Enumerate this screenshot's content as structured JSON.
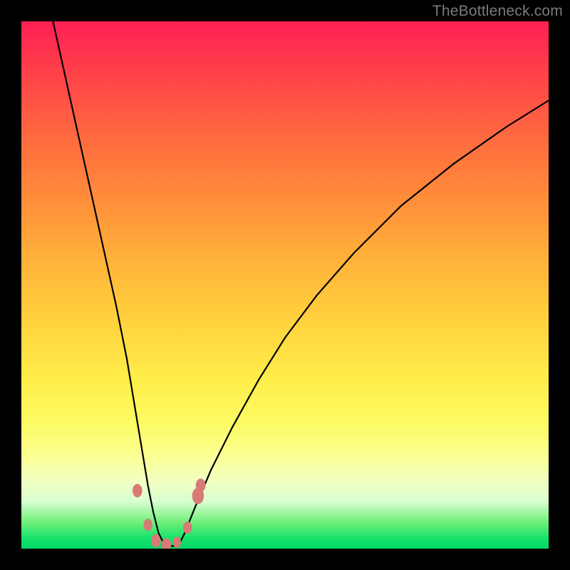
{
  "watermark": "TheBottleneck.com",
  "chart_data": {
    "type": "line",
    "title": "",
    "xlabel": "",
    "ylabel": "",
    "xlim": [
      0,
      100
    ],
    "ylim": [
      0,
      100
    ],
    "series": [
      {
        "name": "bottleneck-curve",
        "x": [
          6,
          8,
          10,
          12,
          14,
          16,
          18,
          20,
          21,
          22,
          23,
          24,
          25,
          26,
          27,
          28,
          29,
          30,
          31,
          33,
          36,
          40,
          45,
          50,
          56,
          63,
          72,
          82,
          92,
          100
        ],
        "y": [
          100,
          91,
          82,
          73,
          64,
          55,
          46,
          36,
          30,
          24,
          18,
          12,
          7,
          3,
          1,
          0.5,
          0.5,
          1,
          3,
          8,
          15,
          23,
          32,
          40,
          48,
          56,
          65,
          73,
          80,
          85
        ]
      }
    ],
    "markers": [
      {
        "name": "dot-left-upper",
        "x": 22.0,
        "y": 11.0,
        "r": 1.3
      },
      {
        "name": "dot-left-mid",
        "x": 24.0,
        "y": 4.5,
        "r": 1.2
      },
      {
        "name": "dot-bottom-1",
        "x": 25.5,
        "y": 1.5,
        "r": 1.3
      },
      {
        "name": "dot-bottom-2",
        "x": 27.5,
        "y": 0.7,
        "r": 1.3
      },
      {
        "name": "dot-bottom-3",
        "x": 29.5,
        "y": 1.2,
        "r": 1.1
      },
      {
        "name": "dot-right-lower",
        "x": 31.5,
        "y": 4.0,
        "r": 1.2
      },
      {
        "name": "dot-right-upper",
        "x": 33.5,
        "y": 10.0,
        "r": 1.6
      },
      {
        "name": "dot-right-upper2",
        "x": 34.0,
        "y": 12.0,
        "r": 1.3
      }
    ],
    "colors": {
      "curve": "#000000",
      "marker": "#d87a76"
    }
  }
}
